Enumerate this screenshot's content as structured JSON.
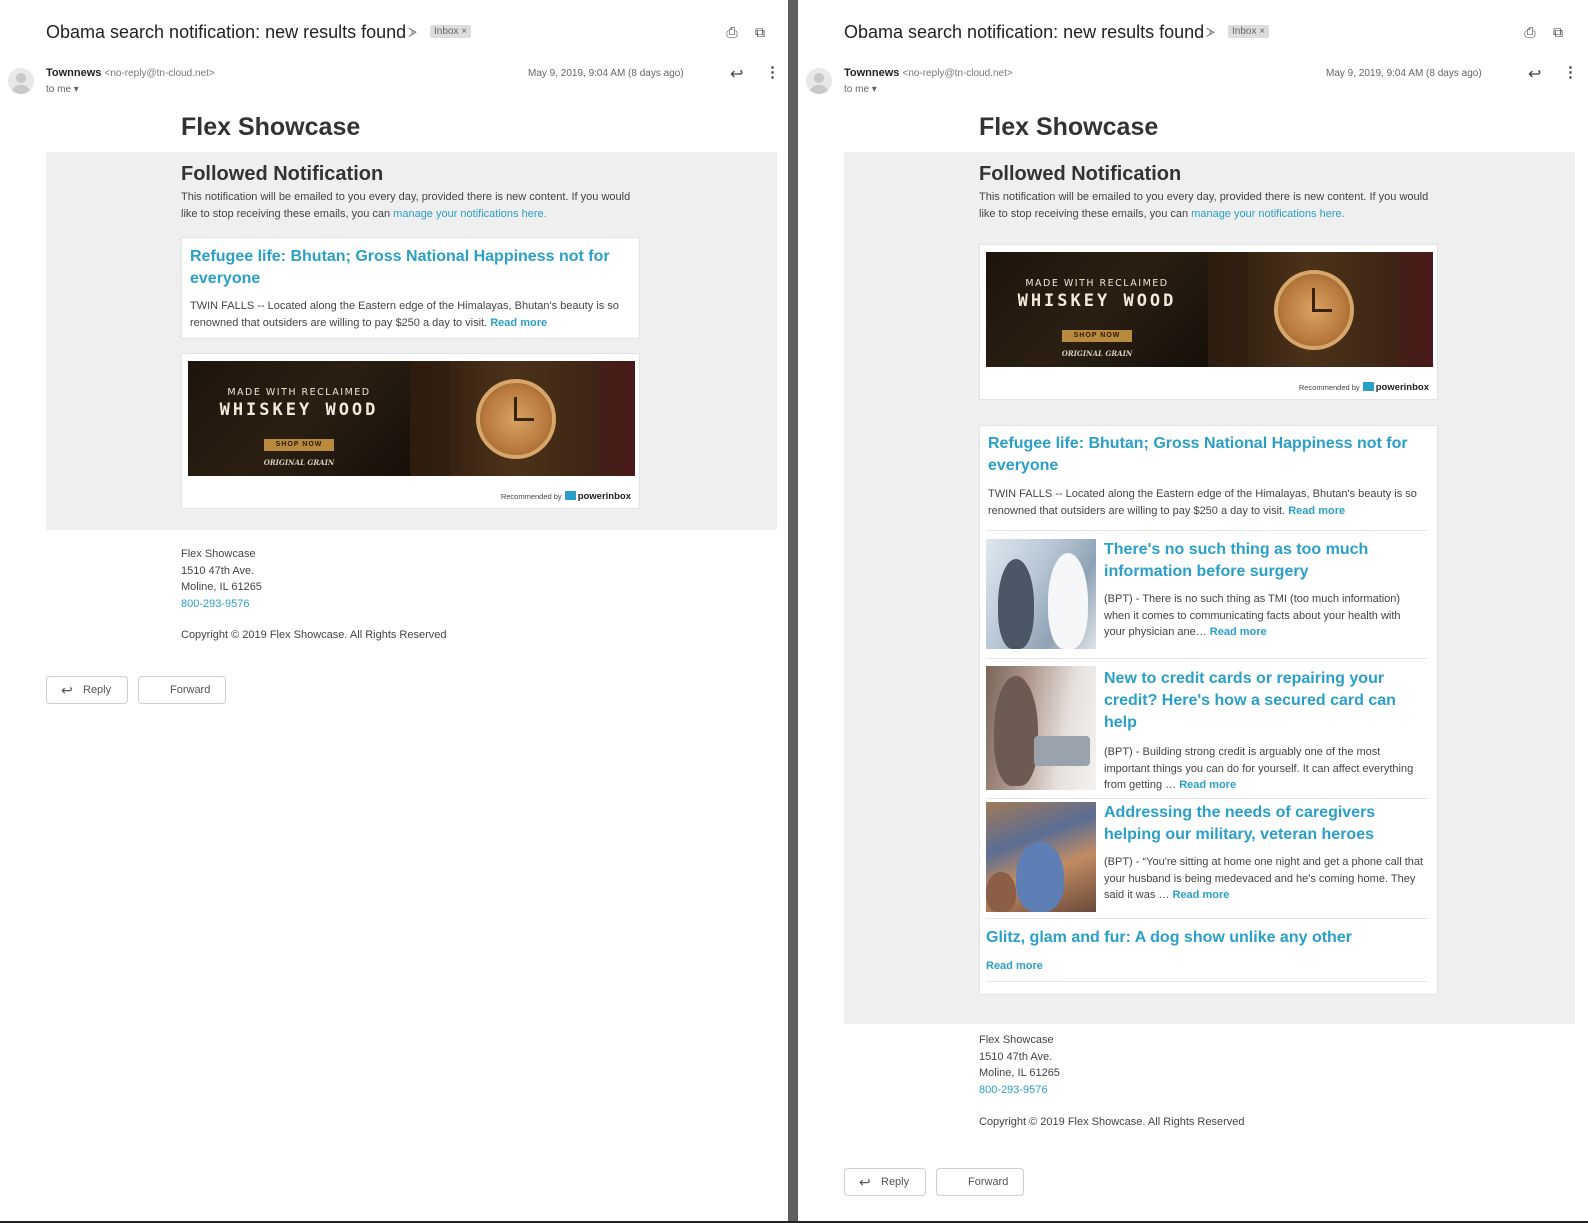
{
  "email": {
    "subject": "Obama search notification: new results found",
    "label_icon": "label-arrow-icon",
    "inbox_badge": "Inbox ×",
    "sender_name": "Townnews",
    "sender_email": "<no-reply@tn-cloud.net>",
    "to_me": "to me",
    "to_me_caret": "▾",
    "date": "May 9, 2019, 9:04 AM (8 days ago)",
    "icons": {
      "print": "print-icon",
      "open_new": "open-in-new-window-icon",
      "reply": "reply-icon",
      "more": "more-vert-icon"
    }
  },
  "newsletter": {
    "brand": "Flex Showcase",
    "notif_title": "Followed Notification",
    "notif_text": "This notification will be emailed to you every day, provided there is new content. If you would like to stop receiving these emails, you can ",
    "notif_link": "manage your notifications here."
  },
  "articles": [
    {
      "title": "Refugee life: Bhutan; Gross National Happiness not for everyone",
      "body": "TWIN FALLS -- Located along the Eastern edge of the Himalayas, Bhutan's beauty is so renowned that outsiders are willing to pay $250 a day to visit.",
      "read_more": "Read more"
    },
    {
      "title": "There's no such thing as too much information before surgery",
      "body": "(BPT) - There is no such thing as TMI (too much information) when it comes to communicating facts about your health with your physician ane…",
      "read_more": "Read more"
    },
    {
      "title": "New to credit cards or repairing your credit? Here's how a secured card can help",
      "body": "(BPT) - Building strong credit is arguably one of the most important things you can do for yourself. It can affect everything from getting …",
      "read_more": "Read more"
    },
    {
      "title": "Addressing the needs of caregivers helping our military, veteran heroes",
      "body": "(BPT) - “You're sitting at home one night and get a phone call that your husband is being medevaced and he's coming home. They said it was …",
      "read_more": "Read more"
    },
    {
      "title": "Glitz, glam and fur: A dog show unlike any other",
      "read_more": "Read more"
    }
  ],
  "ad": {
    "line1": "MADE WITH RECLAIMED",
    "line2": "WHISKEY WOOD",
    "shop": "SHOP NOW",
    "grain": "ORIGINAL GRAIN",
    "recommended_by": "Recommended by",
    "provider": "powerinbox"
  },
  "footer": {
    "name": "Flex Showcase",
    "address1": "1510 47th Ave.",
    "address2": "Moline, IL 61265",
    "phone": "800-293-9576",
    "copyright": "Copyright © 2019 Flex Showcase. All Rights Reserved"
  },
  "actions": {
    "reply": "Reply",
    "forward": "Forward"
  },
  "colors": {
    "link": "#2a9fc9",
    "panel_bg": "#efefef",
    "divider": "#5f5f5f"
  }
}
